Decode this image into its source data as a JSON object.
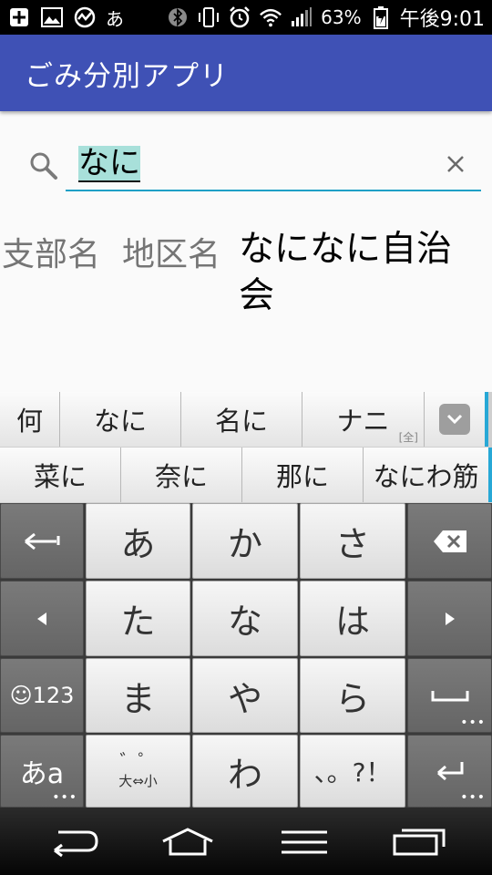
{
  "status_bar": {
    "icons_left": [
      "add-icon",
      "image-icon",
      "activity-icon",
      "input-hiragana-icon"
    ],
    "input_indicator": "あ",
    "icons_right": [
      "bluetooth-icon",
      "vibrate-icon",
      "alarm-icon",
      "wifi-icon",
      "signal-icon",
      "battery-charging-icon"
    ],
    "battery": "63%",
    "time": "午後9:01"
  },
  "app_bar": {
    "title": "ごみ分別アプリ",
    "color": "#3f51b5"
  },
  "search": {
    "value": "なに",
    "underline_color": "#1e9fc6",
    "search_icon": "search-icon",
    "clear_icon": "close-icon"
  },
  "result": {
    "branch_label": "支部名",
    "district_label": "地区名",
    "district_value": "なになに自治会"
  },
  "keyboard": {
    "candidates_row1": [
      "何",
      "なに",
      "名に",
      "ナニ"
    ],
    "candidate_tag": "[全]",
    "expand_icon": "chevron-down-icon",
    "candidates_row2": [
      "菜に",
      "奈に",
      "那に",
      "なにわ筋"
    ],
    "keys": {
      "back_arrow_icon": "undo-arrow-icon",
      "a": "あ",
      "ka": "か",
      "sa": "さ",
      "backspace_icon": "backspace-icon",
      "left_icon": "left-arrow-icon",
      "ta": "た",
      "na": "な",
      "ha": "は",
      "right_icon": "right-arrow-icon",
      "emoji_num": "☺123",
      "ma": "ま",
      "ya": "や",
      "ra": "ら",
      "space_icon": "space-icon",
      "mode": "あa",
      "dakuten_top": "゛゜",
      "dakuten_bottom": "大⇔小",
      "wa": "わ",
      "punct": "、。?！",
      "enter_icon": "enter-icon"
    }
  },
  "nav_bar": {
    "buttons": [
      "back-icon",
      "home-icon",
      "menu-icon",
      "recents-icon"
    ]
  }
}
